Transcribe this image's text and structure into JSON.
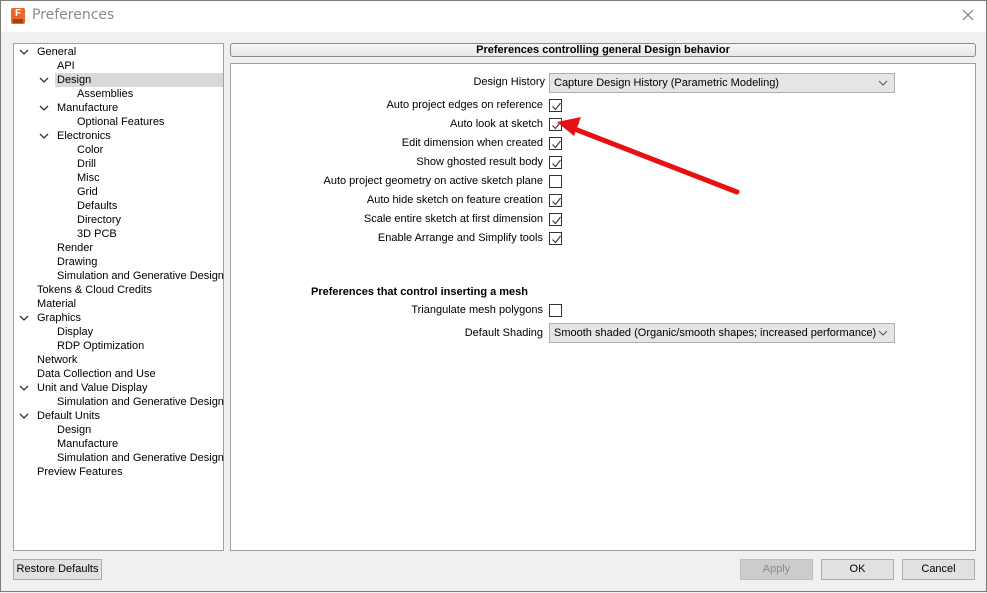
{
  "window": {
    "title": "Preferences",
    "app_icon": "fusion-app-icon",
    "close_icon": "close-icon"
  },
  "tree": {
    "items": [
      {
        "label": "General",
        "level": 0,
        "expanded": true
      },
      {
        "label": "API",
        "level": 1
      },
      {
        "label": "Design",
        "level": 1,
        "expanded": true,
        "selected": true
      },
      {
        "label": "Assemblies",
        "level": 2
      },
      {
        "label": "Manufacture",
        "level": 1,
        "expanded": true
      },
      {
        "label": "Optional Features",
        "level": 2
      },
      {
        "label": "Electronics",
        "level": 1,
        "expanded": true
      },
      {
        "label": "Color",
        "level": 2
      },
      {
        "label": "Drill",
        "level": 2
      },
      {
        "label": "Misc",
        "level": 2
      },
      {
        "label": "Grid",
        "level": 2
      },
      {
        "label": "Defaults",
        "level": 2
      },
      {
        "label": "Directory",
        "level": 2
      },
      {
        "label": "3D PCB",
        "level": 2
      },
      {
        "label": "Render",
        "level": 1
      },
      {
        "label": "Drawing",
        "level": 1
      },
      {
        "label": "Simulation and Generative Design",
        "level": 1
      },
      {
        "label": "Tokens & Cloud Credits",
        "level": 0
      },
      {
        "label": "Material",
        "level": 0
      },
      {
        "label": "Graphics",
        "level": 0,
        "expanded": true
      },
      {
        "label": "Display",
        "level": 1
      },
      {
        "label": "RDP Optimization",
        "level": 1
      },
      {
        "label": "Network",
        "level": 0
      },
      {
        "label": "Data Collection and Use",
        "level": 0
      },
      {
        "label": "Unit and Value Display",
        "level": 0,
        "expanded": true
      },
      {
        "label": "Simulation and Generative Design",
        "level": 1
      },
      {
        "label": "Default Units",
        "level": 0,
        "expanded": true
      },
      {
        "label": "Design",
        "level": 1
      },
      {
        "label": "Manufacture",
        "level": 1
      },
      {
        "label": "Simulation and Generative Design",
        "level": 1
      },
      {
        "label": "Preview Features",
        "level": 0
      }
    ]
  },
  "content": {
    "header": "Preferences controlling general Design behavior",
    "design_history": {
      "label": "Design History",
      "value": "Capture Design History (Parametric Modeling)"
    },
    "options": [
      {
        "label": "Auto project edges on reference",
        "checked": true
      },
      {
        "label": "Auto look at sketch",
        "checked": true
      },
      {
        "label": "Edit dimension when created",
        "checked": true
      },
      {
        "label": "Show ghosted result body",
        "checked": true
      },
      {
        "label": "Auto project geometry on active sketch plane",
        "checked": false
      },
      {
        "label": "Auto hide sketch on feature creation",
        "checked": true
      },
      {
        "label": "Scale entire sketch at first dimension",
        "checked": true
      },
      {
        "label": "Enable Arrange and Simplify tools",
        "checked": true
      }
    ],
    "mesh_section": {
      "title": "Preferences that control inserting a mesh",
      "triangulate": {
        "label": "Triangulate mesh polygons",
        "checked": false
      },
      "default_shading": {
        "label": "Default Shading",
        "value": "Smooth shaded (Organic/smooth shapes; increased performance)"
      }
    }
  },
  "footer": {
    "restore_defaults": "Restore Defaults",
    "apply": "Apply",
    "ok": "OK",
    "cancel": "Cancel"
  },
  "annotation": {
    "color": "#e81010",
    "points_to": "Auto look at sketch"
  }
}
